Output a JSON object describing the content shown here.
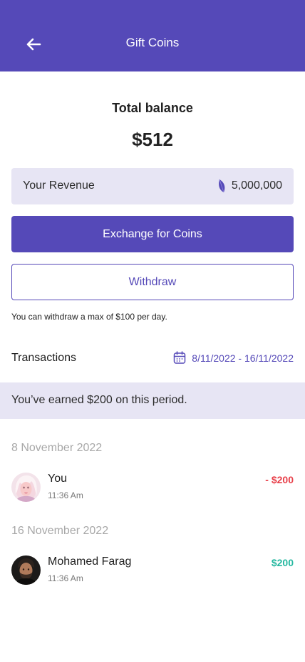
{
  "header": {
    "title": "Gift Coins",
    "back_icon": "arrow-left-icon"
  },
  "balance": {
    "label": "Total balance",
    "value": "$512"
  },
  "revenue": {
    "label": "Your Revenue",
    "amount": "5,000,000",
    "icon": "coin-feather-icon"
  },
  "buttons": {
    "exchange": "Exchange for Coins",
    "withdraw": "Withdraw"
  },
  "note": "You can withdraw a max of $100 per day.",
  "transactions": {
    "title": "Transactions",
    "date_range": "8/11/2022 - 16/11/2022",
    "earned": "You’ve earned $200 on this period.",
    "groups": [
      {
        "date": "8 November 2022",
        "items": [
          {
            "name": "You",
            "time": "11:36 Am",
            "amount": "- $200",
            "type": "debit"
          }
        ]
      },
      {
        "date": "16 November 2022",
        "items": [
          {
            "name": "Mohamed Farag",
            "time": "11:36 Am",
            "amount": "$200",
            "type": "credit"
          }
        ]
      }
    ]
  },
  "colors": {
    "primary": "#5549b8",
    "tint": "#e7e5f4",
    "negative": "#e8404a",
    "positive": "#25b8a0"
  }
}
